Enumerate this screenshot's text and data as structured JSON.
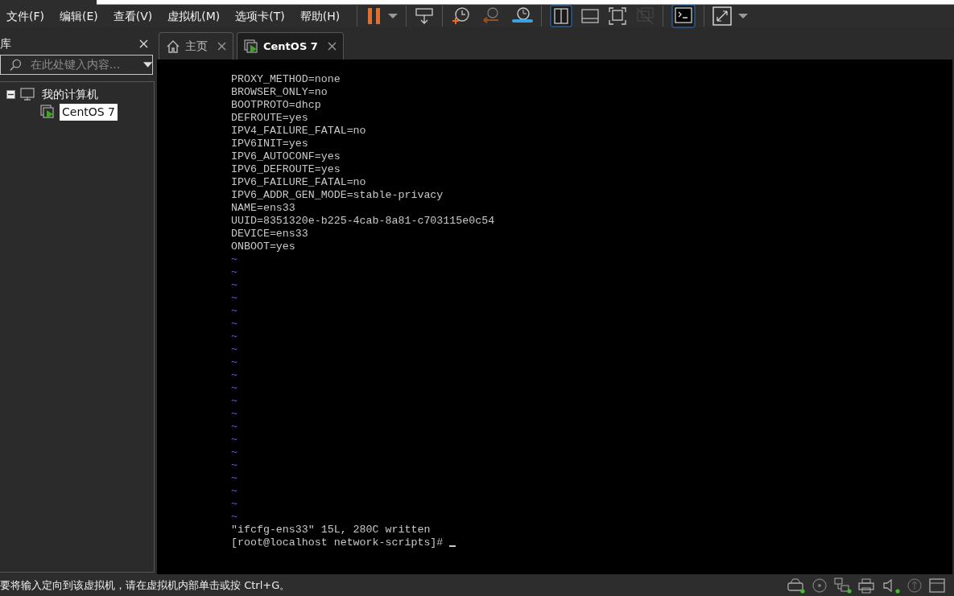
{
  "menu": [
    "文件(F)",
    "编辑(E)",
    "查看(V)",
    "虚拟机(M)",
    "选项卡(T)",
    "帮助(H)"
  ],
  "sidebar": {
    "title": "库",
    "search": {
      "placeholder": "在此处键入内容..."
    },
    "tree": [
      {
        "label": "我的计算机",
        "kind": "computer",
        "expanded": true,
        "selected": false,
        "children": [
          {
            "label": "CentOS 7",
            "kind": "vm",
            "selected": true
          }
        ]
      }
    ]
  },
  "tabs": [
    {
      "label": "主页",
      "kind": "home",
      "selected": false
    },
    {
      "label": "CentOS 7",
      "kind": "vm",
      "selected": true
    }
  ],
  "terminal": {
    "lines": [
      {
        "kind": "text",
        "text": "PROXY_METHOD=none"
      },
      {
        "kind": "text",
        "text": "BROWSER_ONLY=no"
      },
      {
        "kind": "text",
        "text": "BOOTPROTO=dhcp"
      },
      {
        "kind": "text",
        "text": "DEFROUTE=yes"
      },
      {
        "kind": "text",
        "text": "IPV4_FAILURE_FATAL=no"
      },
      {
        "kind": "text",
        "text": "IPV6INIT=yes"
      },
      {
        "kind": "text",
        "text": "IPV6_AUTOCONF=yes"
      },
      {
        "kind": "text",
        "text": "IPV6_DEFROUTE=yes"
      },
      {
        "kind": "text",
        "text": "IPV6_FAILURE_FATAL=no"
      },
      {
        "kind": "text",
        "text": "IPV6_ADDR_GEN_MODE=stable-privacy"
      },
      {
        "kind": "text",
        "text": "NAME=ens33"
      },
      {
        "kind": "text",
        "text": "UUID=8351320e-b225-4cab-8a81-c703115e0c54"
      },
      {
        "kind": "text",
        "text": "DEVICE=ens33"
      },
      {
        "kind": "text",
        "text": "ONBOOT=yes"
      },
      {
        "kind": "filler",
        "text": "~"
      },
      {
        "kind": "filler",
        "text": "~"
      },
      {
        "kind": "filler",
        "text": "~"
      },
      {
        "kind": "filler",
        "text": "~"
      },
      {
        "kind": "filler",
        "text": "~"
      },
      {
        "kind": "filler",
        "text": "~"
      },
      {
        "kind": "filler",
        "text": "~"
      },
      {
        "kind": "filler",
        "text": "~"
      },
      {
        "kind": "filler",
        "text": "~"
      },
      {
        "kind": "filler",
        "text": "~"
      },
      {
        "kind": "filler",
        "text": "~"
      },
      {
        "kind": "filler",
        "text": "~"
      },
      {
        "kind": "filler",
        "text": "~"
      },
      {
        "kind": "filler",
        "text": "~"
      },
      {
        "kind": "filler",
        "text": "~"
      },
      {
        "kind": "filler",
        "text": "~"
      },
      {
        "kind": "filler",
        "text": "~"
      },
      {
        "kind": "filler",
        "text": "~"
      },
      {
        "kind": "filler",
        "text": "~"
      },
      {
        "kind": "filler",
        "text": "~"
      },
      {
        "kind": "filler",
        "text": "~"
      },
      {
        "kind": "message",
        "text": "\"ifcfg-ens33\" 15L, 280C written"
      },
      {
        "kind": "prompt",
        "text": "[root@localhost network-scripts]# "
      }
    ]
  },
  "status_bar": {
    "text": "要将输入定向到该虚拟机，请在虚拟机内部单击或按 Ctrl+G。"
  }
}
